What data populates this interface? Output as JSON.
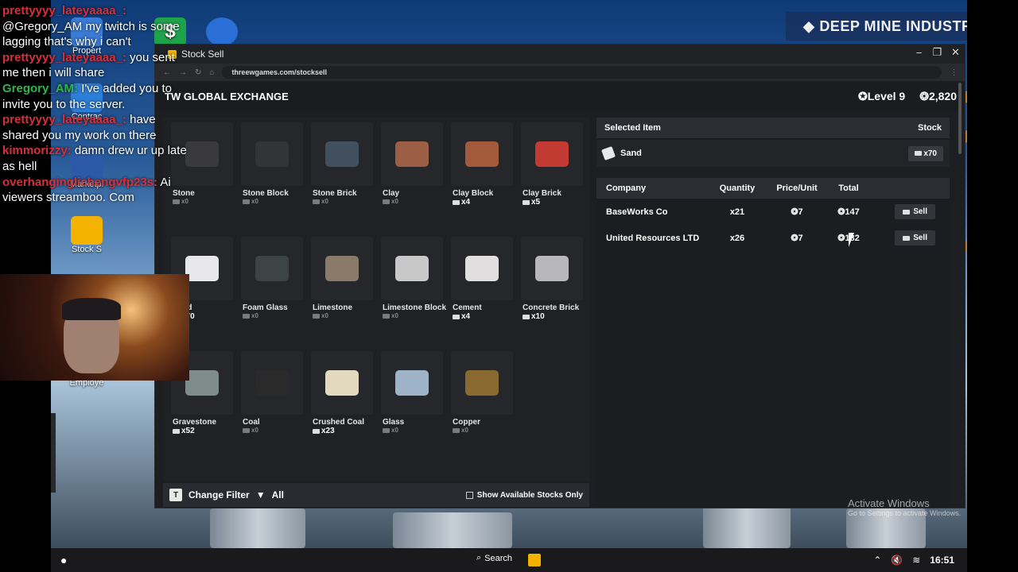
{
  "brand": {
    "title": "DEEP MINE INDUSTRIES",
    "icon": "diamond-icon"
  },
  "desktop_icons": [
    {
      "label": "Propert"
    },
    {
      "label": "Contrac"
    },
    {
      "label": "Marketpl"
    },
    {
      "label": "Stock S"
    },
    {
      "label": "Employe"
    }
  ],
  "chat": [
    {
      "user": "prettyyyy_lateyaaaa_:",
      "text": "@Gregory_AM my twitch is some lagging that's why i can't"
    },
    {
      "user": "prettyyyy_lateyaaaa_:",
      "text": "you sent me then i will share"
    },
    {
      "user": "Gregory_AM:",
      "text": "I've added you to invite you to the server."
    },
    {
      "user": "prettyyyy_lateyaaaa_:",
      "text": "have shared you my work on there"
    },
    {
      "user": "kimmorizzy:",
      "text": "damn drew ur up late as hell"
    },
    {
      "user": "overhanginglichengvfp23s:",
      "text": "Ai viewers streamboo. Com"
    }
  ],
  "window": {
    "title": "Stock Sell",
    "url": "threewgames.com/stocksell",
    "controls": [
      "−",
      "❐",
      "✕"
    ]
  },
  "header": {
    "title": "TW GLOBAL EXCHANGE",
    "level": "Level 9",
    "balance": "2,820"
  },
  "items": [
    {
      "name": "Stone",
      "count": "x0",
      "color": "#3a3a3c"
    },
    {
      "name": "Stone Block",
      "count": "x0",
      "color": "#333438"
    },
    {
      "name": "Stone Brick",
      "count": "x0",
      "color": "#40505e"
    },
    {
      "name": "Clay",
      "count": "x0",
      "color": "#9a5f45"
    },
    {
      "name": "Clay Block",
      "count": "x4",
      "color": "#a35a3c"
    },
    {
      "name": "Clay Brick",
      "count": "x5",
      "color": "#c23a32"
    },
    {
      "name": "Sand",
      "count": "x70",
      "color": "#e8e8ea"
    },
    {
      "name": "Foam Glass",
      "count": "x0",
      "color": "#3e4446"
    },
    {
      "name": "Limestone",
      "count": "x0",
      "color": "#8a7a6a"
    },
    {
      "name": "Limestone Block",
      "count": "x0",
      "color": "#c8c8c8"
    },
    {
      "name": "Cement",
      "count": "x4",
      "color": "#e0dede"
    },
    {
      "name": "Concrete Brick",
      "count": "x10",
      "color": "#b8b8bc"
    },
    {
      "name": "Gravestone",
      "count": "x52",
      "color": "#7e8c8c"
    },
    {
      "name": "Coal",
      "count": "x0",
      "color": "#2a2a2a"
    },
    {
      "name": "Crushed Coal",
      "count": "x23",
      "color": "#e3d8c0"
    },
    {
      "name": "Glass",
      "count": "x0",
      "color": "#9fb3c8"
    },
    {
      "name": "Copper",
      "count": "x0",
      "color": "#8a6a30"
    }
  ],
  "filter": {
    "key": "T",
    "change_label": "Change Filter",
    "filter_value": "All",
    "available_label": "Show Available Stocks Only"
  },
  "selected": {
    "header_item": "Selected Item",
    "header_stock": "Stock",
    "name": "Sand",
    "stock": "x70"
  },
  "table": {
    "headers": {
      "company": "Company",
      "quantity": "Quantity",
      "price": "Price/Unit",
      "total": "Total"
    },
    "rows": [
      {
        "company": "BaseWorks Co",
        "quantity": "x21",
        "price": "7",
        "total": "147",
        "action": "Sell"
      },
      {
        "company": "United Resources LTD",
        "quantity": "x26",
        "price": "7",
        "total": "182",
        "action": "Sell"
      }
    ]
  },
  "taskbar": {
    "search": "Search",
    "time": "16:51"
  },
  "watermark": {
    "line1": "Activate Windows",
    "line2": "Go to Settings to activate Windows."
  }
}
